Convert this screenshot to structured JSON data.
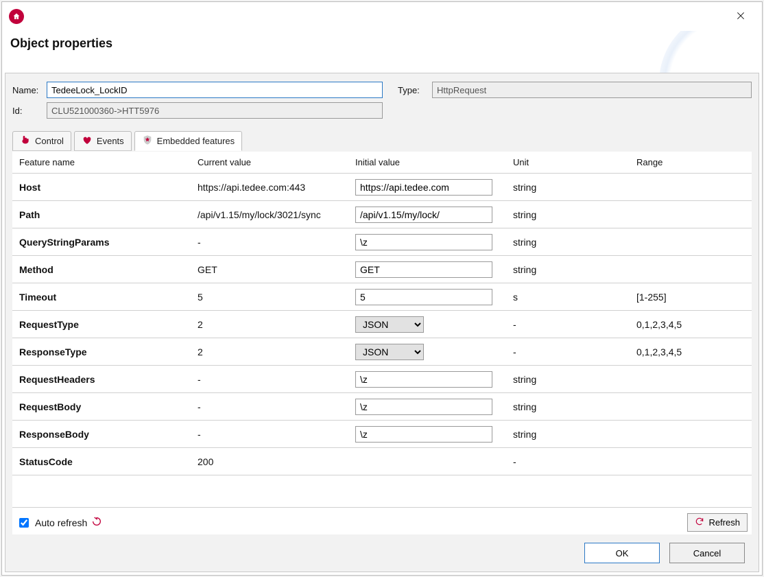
{
  "window_title": "Object properties",
  "labels": {
    "name": "Name:",
    "type": "Type:",
    "id": "Id:",
    "auto_refresh": "Auto refresh",
    "refresh": "Refresh",
    "ok": "OK",
    "cancel": "Cancel"
  },
  "fields": {
    "name_value": "TedeeLock_LockID",
    "type_value": "HttpRequest",
    "id_value": "CLU521000360->HTT5976"
  },
  "tabs": {
    "control": "Control",
    "events": "Events",
    "embedded": "Embedded features"
  },
  "columns": {
    "feature": "Feature name",
    "current": "Current value",
    "initial": "Initial value",
    "unit": "Unit",
    "range": "Range"
  },
  "rows": [
    {
      "name": "Host",
      "current": "https://api.tedee.com:443",
      "initial_type": "text",
      "initial": "https://api.tedee.com",
      "unit": "string",
      "range": ""
    },
    {
      "name": "Path",
      "current": "/api/v1.15/my/lock/3021/sync",
      "initial_type": "text",
      "initial": "/api/v1.15/my/lock/",
      "unit": "string",
      "range": ""
    },
    {
      "name": "QueryStringParams",
      "current": "-",
      "initial_type": "text",
      "initial": "\\z",
      "unit": "string",
      "range": ""
    },
    {
      "name": "Method",
      "current": "GET",
      "initial_type": "text",
      "initial": "GET",
      "unit": "string",
      "range": ""
    },
    {
      "name": "Timeout",
      "current": "5",
      "initial_type": "text",
      "initial": "5",
      "unit": "s",
      "range": "[1-255]"
    },
    {
      "name": "RequestType",
      "current": "2",
      "initial_type": "select",
      "initial": "JSON",
      "unit": "-",
      "range": "0,1,2,3,4,5"
    },
    {
      "name": "ResponseType",
      "current": "2",
      "initial_type": "select",
      "initial": "JSON",
      "unit": "-",
      "range": "0,1,2,3,4,5"
    },
    {
      "name": "RequestHeaders",
      "current": "-",
      "initial_type": "text",
      "initial": "\\z",
      "unit": "string",
      "range": ""
    },
    {
      "name": "RequestBody",
      "current": "-",
      "initial_type": "text",
      "initial": "\\z",
      "unit": "string",
      "range": ""
    },
    {
      "name": "ResponseBody",
      "current": "-",
      "initial_type": "text",
      "initial": "\\z",
      "unit": "string",
      "range": ""
    },
    {
      "name": "StatusCode",
      "current": "200",
      "initial_type": "none",
      "initial": "",
      "unit": "-",
      "range": ""
    }
  ],
  "auto_refresh_checked": true,
  "select_options": [
    "JSON"
  ]
}
